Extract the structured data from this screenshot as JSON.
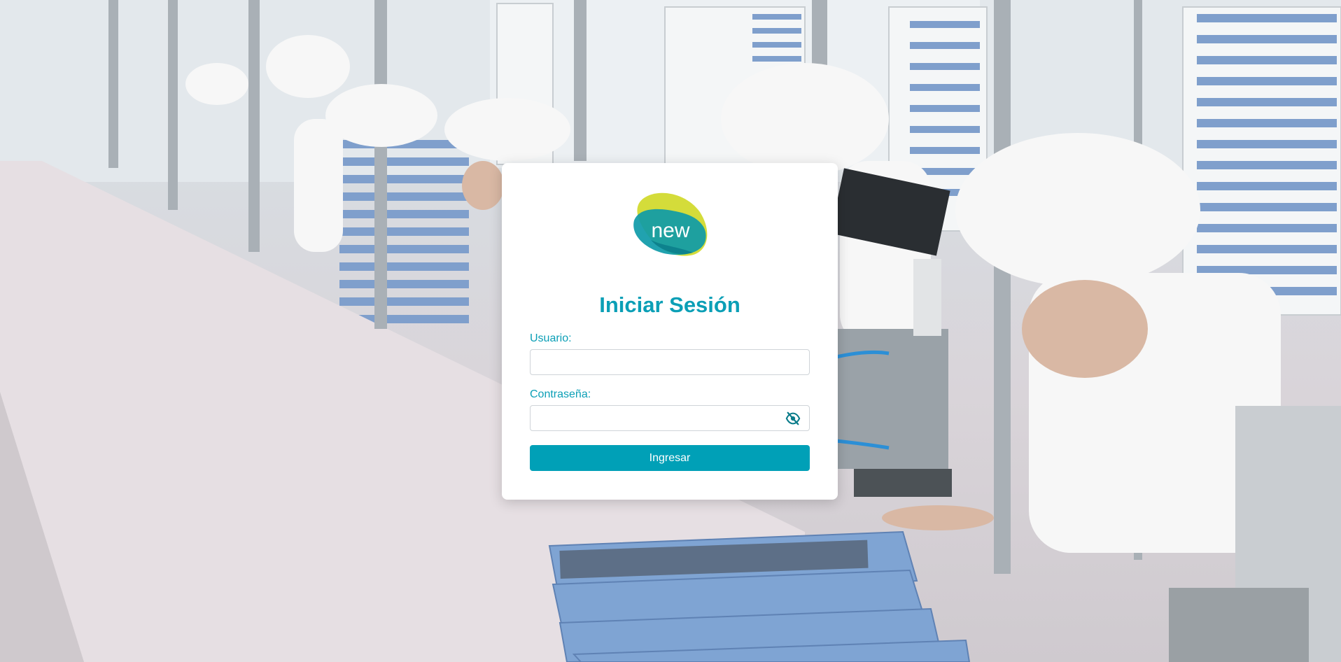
{
  "background": {
    "description_icon": "factory-photo"
  },
  "logo": {
    "text": "new",
    "colors": {
      "lime": "#d4dc3a",
      "teal": "#0e9aa8",
      "teal_dark": "#0a7c8a"
    }
  },
  "login": {
    "title": "Iniciar Sesión",
    "username_label": "Usuario:",
    "username_value": "",
    "password_label": "Contraseña:",
    "password_value": "",
    "toggle_icon": "eye-slash-icon",
    "submit_label": "Ingresar"
  },
  "colors": {
    "accent": "#00a0b7",
    "title": "#0b9fb6",
    "card_bg": "#ffffff"
  }
}
